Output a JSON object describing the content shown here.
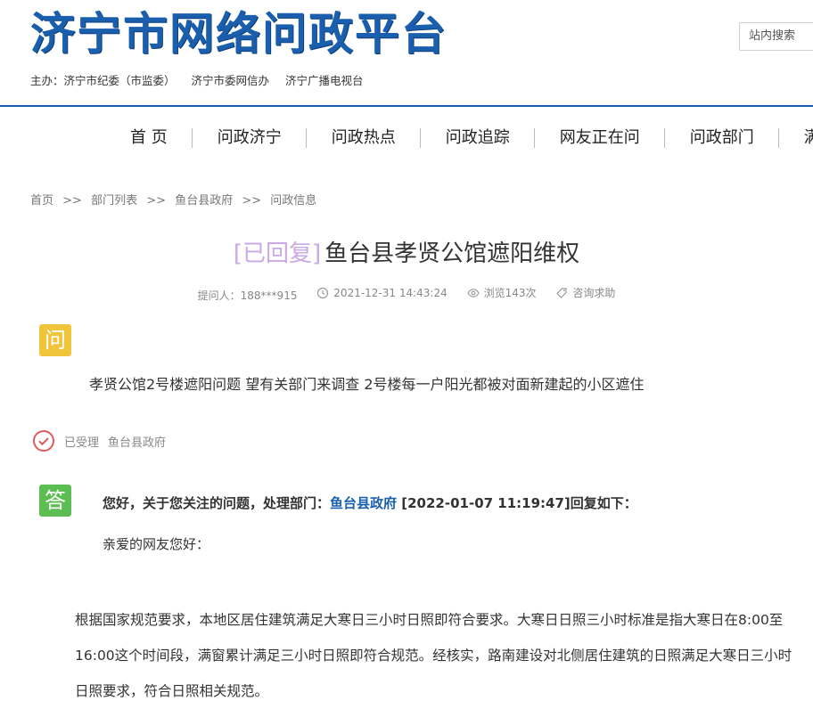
{
  "header": {
    "site_title": "济宁市网络问政平台",
    "sponsors": [
      "主办：济宁市纪委（市监委）",
      "济宁市委网信办",
      "济宁广播电视台"
    ],
    "search_placeholder": "站内搜索",
    "brand_color": "#1a5fae"
  },
  "nav": {
    "items": [
      {
        "label": "首 页"
      },
      {
        "label": "问政济宁"
      },
      {
        "label": "问政热点"
      },
      {
        "label": "问政追踪"
      },
      {
        "label": "网友正在问"
      },
      {
        "label": "问政部门"
      },
      {
        "label": "满意"
      }
    ]
  },
  "breadcrumb": {
    "items": [
      "首页",
      "部门列表",
      "鱼台县政府",
      "问政信息"
    ],
    "separator": ">>"
  },
  "post": {
    "status": "[已回复]",
    "status_color": "#c9a9e6",
    "title": "鱼台县孝贤公馆遮阳维权",
    "asker": "提问人：188***915",
    "datetime": "2021-12-31 14:43:24",
    "views": "浏览143次",
    "category": "咨询求助",
    "question_badge": "问",
    "question_badge_color": "#f0c53c",
    "question_text": "孝贤公馆2号楼遮阳问题  望有关部门来调查  2号楼每一户阳光都被对面新建起的小区遮住"
  },
  "accepted": {
    "status": "已受理",
    "department": "鱼台县政府"
  },
  "reply": {
    "badge": "答",
    "badge_color": "#5cbe52",
    "head_prefix": "您好，关于您关注的问题，处理部门：",
    "department": "鱼台县政府",
    "head_suffix": "[2022-01-07 11:19:47]回复如下：",
    "greeting": "亲爱的网友您好：",
    "body": "根据国家规范要求，本地区居住建筑满足大寒日三小时日照即符合要求。大寒日日照三小时标准是指大寒日在8:00至16:00这个时间段，满窗累计满足三小时日照即符合规范。经核实，路南建设对北侧居住建筑的日照满足大寒日三小时日照要求，符合日照相关规范。"
  }
}
